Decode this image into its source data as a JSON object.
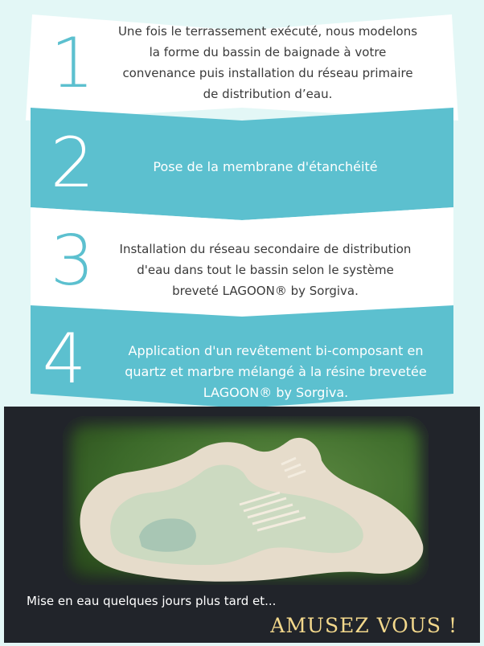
{
  "steps": [
    {
      "number": "1",
      "text": "Une fois le terrassement exécuté, nous modelons la forme du bassin de baignade à votre convenance puis installation du réseau primaire de distribution d’eau.",
      "lines": [
        "Une fois le terrassement exécuté, nous modelons",
        "la forme du bassin de baignade à votre",
        "convenance puis installation du réseau primaire",
        "de distribution d’eau."
      ]
    },
    {
      "number": "2",
      "text": "Pose de la membrane d'étanchéité",
      "lines": [
        "Pose de la membrane d'étanchéité"
      ]
    },
    {
      "number": "3",
      "text": "Installation du réseau secondaire de distribution d'eau dans tout le bassin selon le système breveté LAGOON® by Sorgiva.",
      "lines": [
        "Installation du réseau secondaire de distribution",
        "d'eau dans tout le bassin selon le système",
        "breveté LAGOON® by Sorgiva."
      ]
    },
    {
      "number": "4",
      "text": "Application d'un revêtement bi-composant en quartz et marbre mélangé à la résine brevetée LAGOON® by Sorgiva.",
      "lines": [
        "Application d'un revêtement bi-composant en",
        "quartz et marbre mélangé à la résine brevetée",
        "LAGOON® by Sorgiva."
      ]
    }
  ],
  "footer": {
    "caption": "Mise en eau quelques jours plus tard et...",
    "slogan": "AMUSEZ VOUS !"
  },
  "colors": {
    "teal": "#5cc0cf",
    "white_band": "#ffffff",
    "page_bg": "#e3f7f6",
    "dark_panel": "#21242a",
    "slogan": "#f3d88c"
  }
}
